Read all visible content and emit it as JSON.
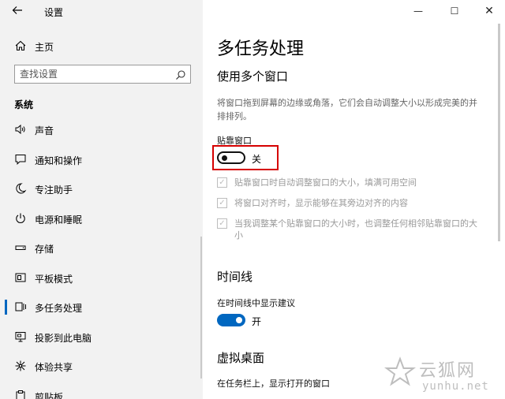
{
  "sidebar": {
    "back_icon": "back-arrow-icon",
    "app_title": "设置",
    "home_label": "主页",
    "search_placeholder": "查找设置",
    "section_label": "系统",
    "items": [
      {
        "label": "声音",
        "icon": "speaker-icon"
      },
      {
        "label": "通知和操作",
        "icon": "notification-icon"
      },
      {
        "label": "专注助手",
        "icon": "moon-icon"
      },
      {
        "label": "电源和睡眠",
        "icon": "power-icon"
      },
      {
        "label": "存储",
        "icon": "storage-icon"
      },
      {
        "label": "平板模式",
        "icon": "tablet-icon"
      },
      {
        "label": "多任务处理",
        "icon": "multitask-icon",
        "active": true
      },
      {
        "label": "投影到此电脑",
        "icon": "project-icon"
      },
      {
        "label": "体验共享",
        "icon": "share-icon"
      },
      {
        "label": "剪贴板",
        "icon": "clipboard-icon"
      }
    ]
  },
  "window": {
    "minimize": "—",
    "maximize": "☐",
    "close": "✕"
  },
  "main": {
    "title": "多任务处理",
    "snap": {
      "heading": "使用多个窗口",
      "description": "将窗口拖到屏幕的边缘或角落，它们会自动调整大小以形成完美的并排排列。",
      "setting_label": "贴靠窗口",
      "toggle_state": "关",
      "options": [
        {
          "label": "贴靠窗口时自动调整窗口的大小，填满可用空间",
          "checked": true
        },
        {
          "label": "将窗口对齐时，显示能够在其旁边对齐的内容",
          "checked": true
        },
        {
          "label": "当我调整某个贴靠窗口的大小时，也调整任何相邻贴靠窗口的大小",
          "checked": true
        }
      ]
    },
    "timeline": {
      "heading": "时间线",
      "setting_label": "在时间线中显示建议",
      "toggle_state": "开"
    },
    "virtual_desktops": {
      "heading": "虚拟桌面",
      "setting_label": "在任务栏上，显示打开的窗口"
    }
  },
  "watermark": {
    "cn": "云狐网",
    "en": "yunhu.net"
  },
  "colors": {
    "accent": "#0067c0",
    "highlight_box": "#d60000",
    "sidebar_bg": "#f2f2f2"
  }
}
